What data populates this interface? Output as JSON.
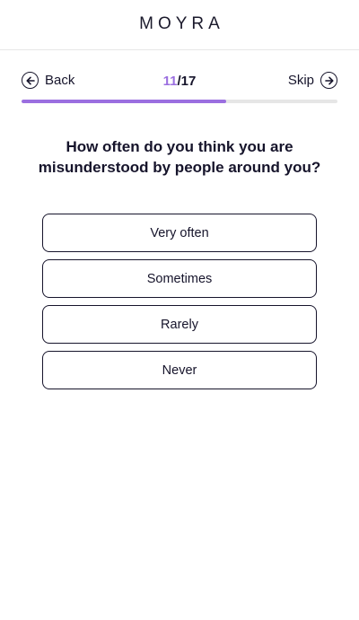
{
  "header": {
    "logo_text": "MOYRA"
  },
  "nav": {
    "back_label": "Back",
    "skip_label": "Skip",
    "back_icon": "arrow-left-circle-icon",
    "skip_icon": "arrow-right-circle-icon"
  },
  "progress": {
    "current": "11",
    "separator": "/",
    "total": "17",
    "fraction": 0.647
  },
  "question": {
    "text": "How often do you think you are misunderstood by people around you?"
  },
  "options": [
    {
      "label": "Very often"
    },
    {
      "label": "Sometimes"
    },
    {
      "label": "Rarely"
    },
    {
      "label": "Never"
    }
  ],
  "colors": {
    "accent": "#9b6fe0",
    "text": "#16142b",
    "track": "#e6e6e6"
  }
}
